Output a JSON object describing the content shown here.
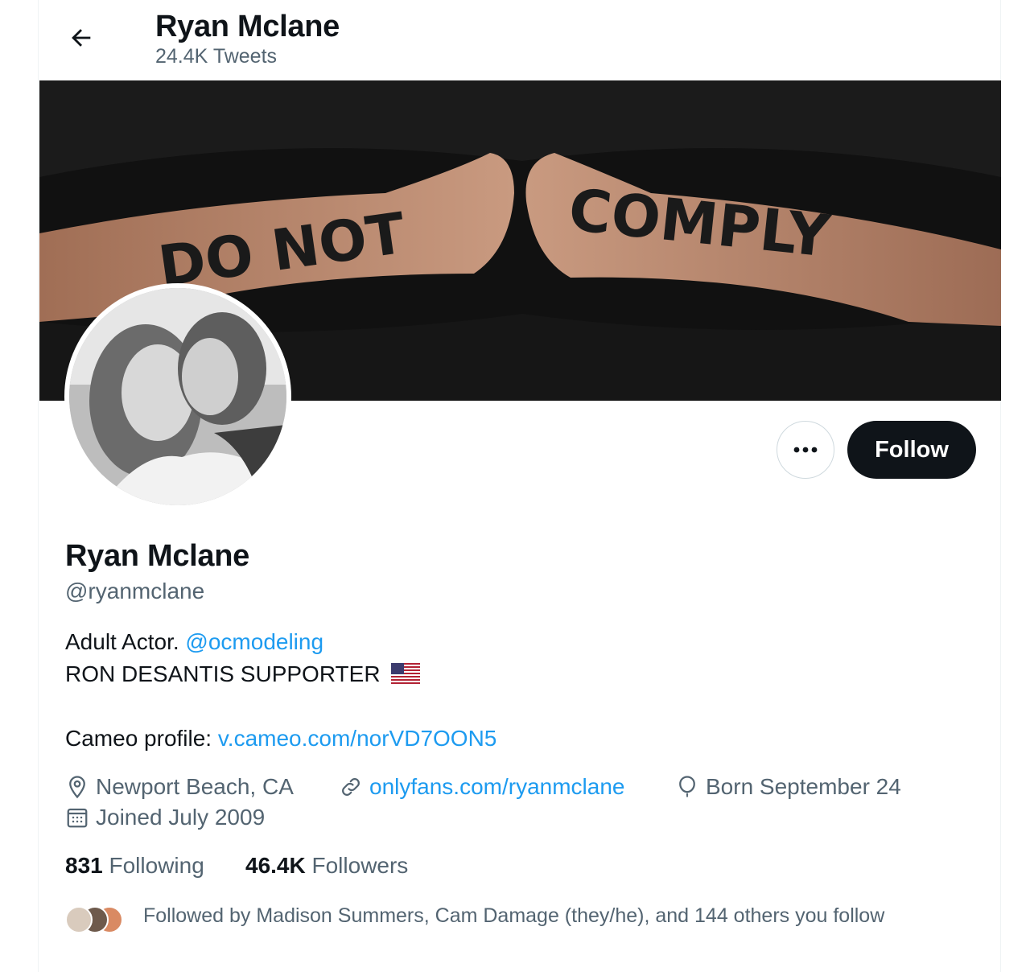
{
  "header": {
    "name": "Ryan Mclane",
    "tweet_count": "24.4K Tweets"
  },
  "banner": {
    "text_left": "DO NOT",
    "text_right": "COMPLY"
  },
  "actions": {
    "more_label": "•••",
    "follow_label": "Follow"
  },
  "profile": {
    "name": "Ryan Mclane",
    "handle": "@ryanmclane",
    "bio_line1_prefix": "Adult Actor. ",
    "bio_line1_mention": "@ocmodeling",
    "bio_line2": "RON DESANTIS SUPPORTER",
    "bio_line3_prefix": "Cameo profile: ",
    "bio_line3_link": "v.cameo.com/norVD7OON5"
  },
  "meta": {
    "location": "Newport Beach, CA",
    "website": "onlyfans.com/ryanmclane",
    "birthday": "Born September 24",
    "joined": "Joined July 2009"
  },
  "stats": {
    "following_count": "831",
    "following_label": "Following",
    "followers_count": "46.4K",
    "followers_label": "Followers"
  },
  "followed_by": {
    "text": "Followed by Madison Summers, Cam Damage (they/he), and 144 others you follow"
  },
  "colors": {
    "link": "#1d9bf0",
    "secondary_text": "#536471",
    "primary_text": "#0f1419"
  }
}
